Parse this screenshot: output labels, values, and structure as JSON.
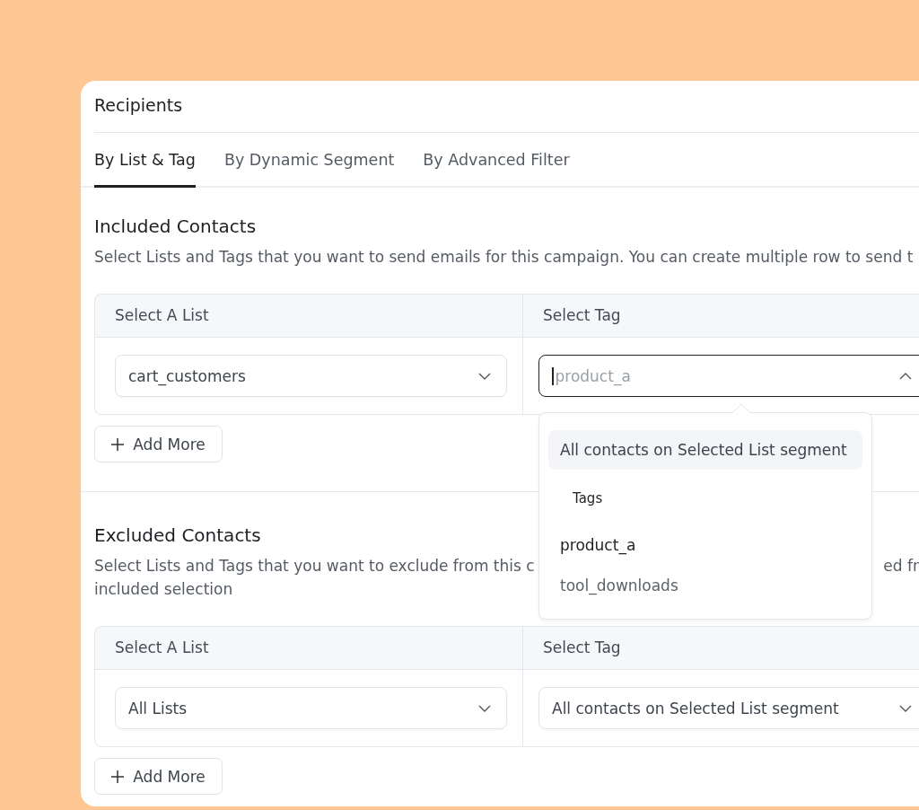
{
  "header": {
    "title": "Recipients"
  },
  "tabs": [
    {
      "label": "By List & Tag",
      "selected": true
    },
    {
      "label": "By Dynamic Segment",
      "selected": false
    },
    {
      "label": "By Advanced Filter",
      "selected": false
    }
  ],
  "sections": [
    {
      "heading": "Included Contacts",
      "description_lines": [
        [
          "Select Lists and Tags that you want to send emails for this campaign. You can create multiple row to send t"
        ]
      ],
      "table": {
        "columns": [
          "Select A List",
          "Select Tag"
        ],
        "rows": [
          {
            "list": {
              "value": "cart_customers",
              "open": false
            },
            "tag": {
              "placeholder": "product_a",
              "focused": true,
              "open": true
            }
          }
        ]
      },
      "add_button": "Add More"
    },
    {
      "heading": "Excluded Contacts",
      "description_lines": [
        [
          "Select Lists and Tags that you want to exclude from this c",
          "ed fr"
        ],
        [
          "included selection"
        ]
      ],
      "table": {
        "columns": [
          "Select A List",
          "Select Tag"
        ],
        "rows": [
          {
            "list": {
              "value": "All Lists",
              "open": false
            },
            "tag": {
              "value": "All contacts on Selected List segment",
              "focused": false,
              "open": false
            }
          }
        ]
      },
      "add_button": "Add More"
    }
  ],
  "tag_dropdown": {
    "options": [
      {
        "label": "All contacts on Selected List segment",
        "highlighted": true
      }
    ],
    "group_label": "Tags",
    "tags": [
      {
        "label": "product_a",
        "selected": true
      },
      {
        "label": "tool_downloads",
        "selected": false
      }
    ]
  }
}
